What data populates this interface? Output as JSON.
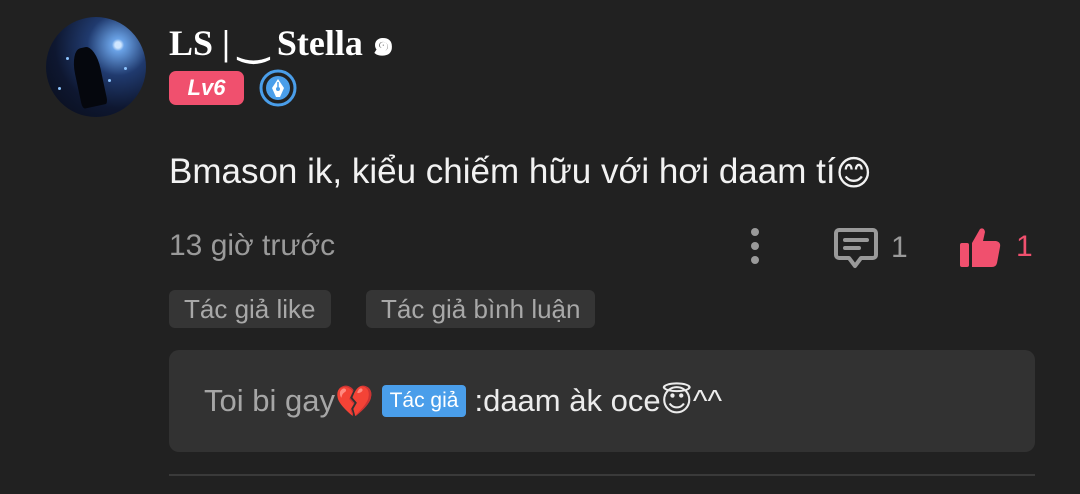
{
  "comment": {
    "username": "LS | ‿ Stella ๑",
    "level": "Lv6",
    "text": "Bmason ik, kiểu chiếm hữu với hơi daam tí",
    "text_emoji": "😊",
    "timestamp": "13 giờ trước",
    "reply_count": "1",
    "like_count": "1"
  },
  "tags": [
    {
      "label": "Tác giả like"
    },
    {
      "label": "Tác giả bình luận"
    }
  ],
  "reply": {
    "user": "Toi bi gay",
    "user_emoji": "💔",
    "author_tag": "Tác giả",
    "separator": " : ",
    "text": "daam àk oce ",
    "text_emoji": "😇",
    "suffix": "^^"
  },
  "icons": {
    "more": "more-vertical-icon",
    "reply": "comment-icon",
    "like": "thumbs-up-icon",
    "author": "pen-nib-badge-icon"
  },
  "colors": {
    "background": "#212121",
    "like_accent": "#f0506e",
    "level_badge": "#f0506e",
    "author_tag": "#4a9eea",
    "tag_background": "#353535",
    "reply_box": "#323232"
  }
}
